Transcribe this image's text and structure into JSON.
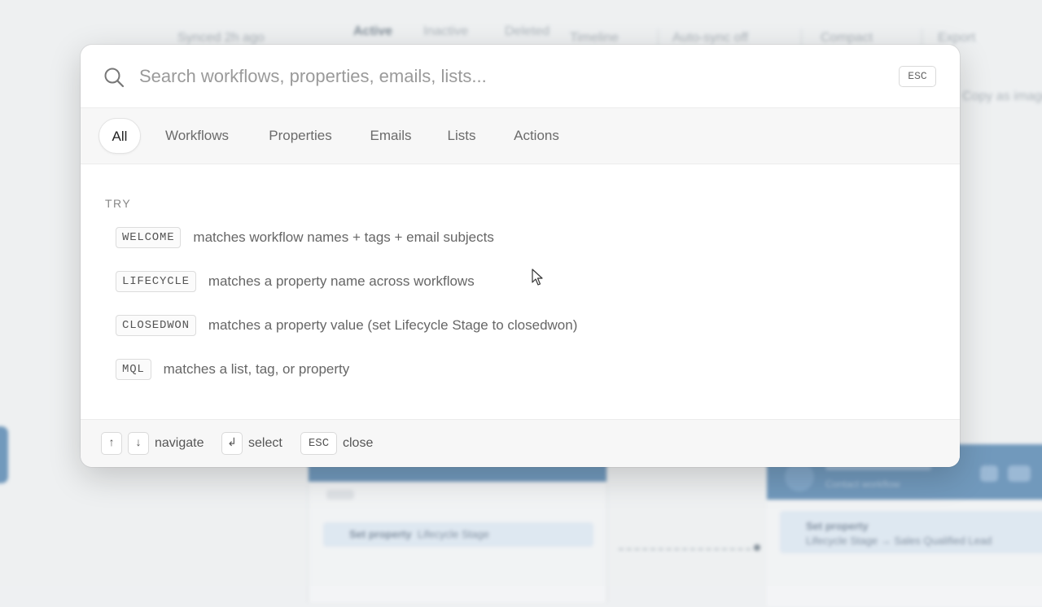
{
  "background": {
    "toolbar": {
      "synced": "Synced 2h ago",
      "status_tabs": [
        "Active",
        "Inactive",
        "Deleted"
      ],
      "timeline": "Timeline",
      "auto_sync": "Auto-sync off",
      "compact": "Compact",
      "export": "Export"
    },
    "copy_as_image": "Copy as image",
    "column": {
      "row_action": "Set property",
      "row_detail": "Lifecycle Stage"
    },
    "right_card": {
      "subtitle": "Contact workflow",
      "row_action": "Set property",
      "row_detail": "Lifecycle Stage → Sales Qualified Lead"
    }
  },
  "search": {
    "placeholder": "Search workflows, properties, emails, lists...",
    "value": "",
    "esc_label": "ESC"
  },
  "tabs": [
    {
      "label": "All",
      "active": true
    },
    {
      "label": "Workflows",
      "active": false
    },
    {
      "label": "Properties",
      "active": false
    },
    {
      "label": "Emails",
      "active": false
    },
    {
      "label": "Lists",
      "active": false
    },
    {
      "label": "Actions",
      "active": false
    }
  ],
  "try_section": {
    "heading": "TRY",
    "tips": [
      {
        "key": "WELCOME",
        "description": "matches workflow names + tags + email subjects"
      },
      {
        "key": "LIFECYCLE",
        "description": "matches a property name across workflows"
      },
      {
        "key": "CLOSEDWON",
        "description": "matches a property value (set Lifecycle Stage to closedwon)"
      },
      {
        "key": "MQL",
        "description": "matches a list, tag, or property"
      }
    ]
  },
  "footer": {
    "up_key": "↑",
    "down_key": "↓",
    "navigate_label": "navigate",
    "enter_key": "↲",
    "select_label": "select",
    "esc_key": "ESC",
    "close_label": "close"
  },
  "colors": {
    "accent_blue": "#2f6aa0",
    "modal_bg": "#ffffff",
    "footer_bg": "#f7f7f7"
  },
  "icons": {
    "search": "search-icon",
    "cursor": "mouse-pointer-icon"
  }
}
